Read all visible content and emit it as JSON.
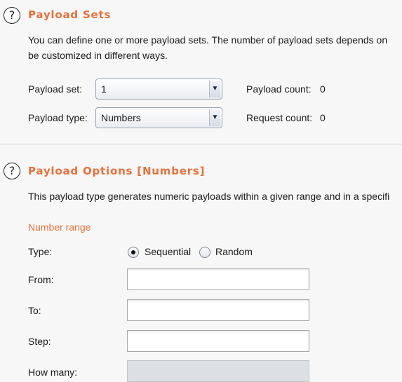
{
  "payload_sets": {
    "title": "Payload Sets",
    "description_line1": "You can define one or more payload sets. The number of payload sets depends on",
    "description_line2": "be customized in different ways.",
    "payload_set_label": "Payload set:",
    "payload_set_value": "1",
    "payload_type_label": "Payload type:",
    "payload_type_value": "Numbers",
    "payload_count_label": "Payload count:",
    "payload_count_value": "0",
    "request_count_label": "Request count:",
    "request_count_value": "0"
  },
  "payload_options": {
    "title": "Payload Options [Numbers]",
    "description": "This payload type generates numeric payloads within a given range and in a specifi",
    "number_range_heading": "Number range",
    "type_label": "Type:",
    "type_options": [
      "Sequential",
      "Random"
    ],
    "type_selected": "Sequential",
    "from_label": "From:",
    "from_value": "",
    "to_label": "To:",
    "to_value": "",
    "step_label": "Step:",
    "step_value": "",
    "how_many_label": "How many:",
    "how_many_value": ""
  },
  "icons": {
    "help": "help-icon",
    "dropdown": "chevron-down-icon",
    "help_glyph": "?",
    "arrow_glyph": "▼"
  },
  "colors": {
    "accent": "#e8703a",
    "background": "#f7f7f7",
    "divider": "#cfcfcf"
  }
}
